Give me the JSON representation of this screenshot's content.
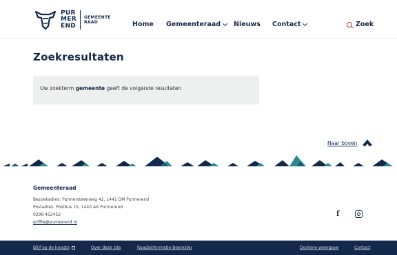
{
  "brand": {
    "words": [
      "PUR",
      "MER",
      "END"
    ],
    "raad": [
      "GEMEENTE",
      "RAAD"
    ]
  },
  "nav": {
    "items": [
      {
        "label": "Home"
      },
      {
        "label": "Gemeenteraad",
        "dropdown": true
      },
      {
        "label": "Nieuws"
      },
      {
        "label": "Contact",
        "dropdown": true
      }
    ],
    "search_label": "Zoek"
  },
  "main": {
    "title": "Zoekresultaten",
    "result_prefix": "Uw zoekterm ",
    "search_term": "gemeente",
    "result_suffix": " geeft de volgende resultaten"
  },
  "back_to_top": "Naar boven",
  "footer": {
    "title": "Gemeenteraad",
    "visit_address": "Bezoekadres: Purmersteenweg 42, 1441 DM Purmerend",
    "postal_address": "Postadres: Postbus 15, 1440 AA Purmerend",
    "phone": "0299 452452",
    "email": "griffie@purmerend.nl",
    "social": [
      "facebook-icon",
      "instagram-icon"
    ]
  },
  "bottom_links": {
    "blijf": "Blijf op de hoogte",
    "over": "Over deze site",
    "raads": "Raadsinformatie Beemster",
    "donker": "Donkere weergave",
    "contact": "Contact"
  },
  "colors": {
    "navy": "#14284b",
    "teal": "#2e8b8b",
    "accent_red": "#c0392b",
    "box_bg": "#eef0ef"
  }
}
